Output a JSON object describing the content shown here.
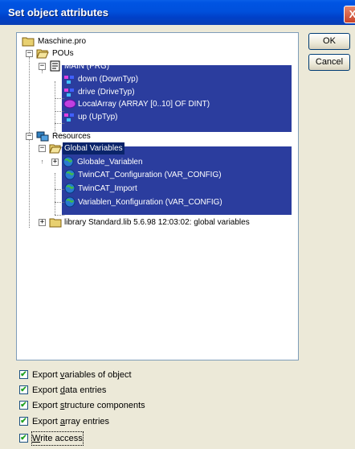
{
  "window": {
    "title": "Set object attributes",
    "close_glyph": "X"
  },
  "buttons": {
    "ok_label": "OK",
    "cancel_label": "Cancel"
  },
  "tree": {
    "root": "Maschine.pro",
    "pous": "POUs",
    "main": "MAIN (PRG)",
    "down": "down (DownTyp)",
    "drive": "drive (DriveTyp)",
    "localarray": "LocalArray (ARRAY [0..10] OF DINT)",
    "up": "up (UpTyp)",
    "resources": "Resources",
    "global_variables": "Global Variables",
    "globale_variablen": "Globale_Variablen",
    "twincat_configuration": "TwinCAT_Configuration (VAR_CONFIG)",
    "twincat_import": "TwinCAT_Import",
    "variablen_konfiguration": "Variablen_Konfiguration (VAR_CONFIG)",
    "library": "library Standard.lib 5.6.98 12:03:02: global variables"
  },
  "options": {
    "export_variables_pre": "Export ",
    "export_variables_u": "v",
    "export_variables_post": "ariables of object",
    "export_data_pre": "Export ",
    "export_data_u": "d",
    "export_data_post": "ata entries",
    "export_structure_pre": "Export ",
    "export_structure_u": "s",
    "export_structure_post": "tructure components",
    "export_array_pre": "Export ",
    "export_array_u": "a",
    "export_array_post": "rray entries",
    "write_access_pre": "",
    "write_access_u": "W",
    "write_access_post": "rite access"
  },
  "colors": {
    "selection": "#0a246a",
    "titlebar": "#0054e3",
    "dialog_bg": "#ece9d8"
  }
}
